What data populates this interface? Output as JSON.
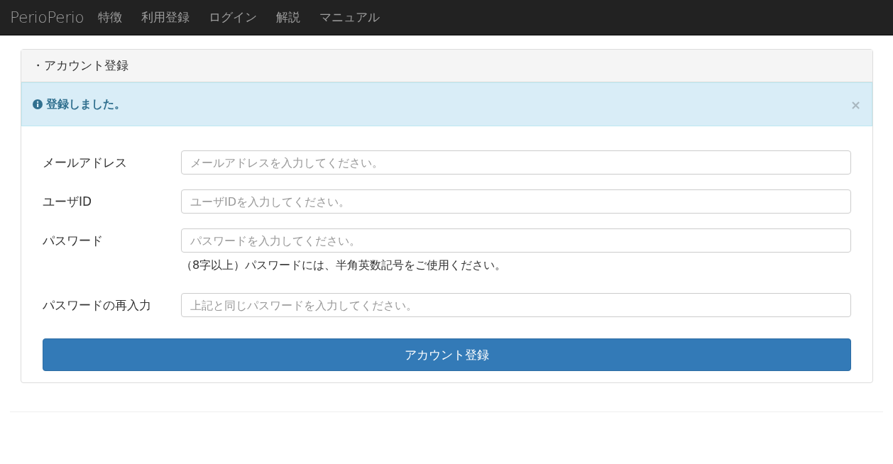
{
  "navbar": {
    "brand": "PerioPerio",
    "links": [
      "特徴",
      "利用登録",
      "ログイン",
      "解説",
      "マニュアル"
    ]
  },
  "panel": {
    "title": "・アカウント登録",
    "alert": {
      "message": "登録しました。",
      "close": "×"
    },
    "fields": [
      {
        "label": "メールアドレス",
        "placeholder": "メールアドレスを入力してください。"
      },
      {
        "label": "ユーザID",
        "placeholder": "ユーザIDを入力してください。"
      },
      {
        "label": "パスワード",
        "placeholder": "パスワードを入力してください。",
        "help": "（8字以上）パスワードには、半角英数記号をご使用ください。"
      },
      {
        "label": "パスワードの再入力",
        "placeholder": "上記と同じパスワードを入力してください。"
      }
    ],
    "submit": "アカウント登録"
  }
}
